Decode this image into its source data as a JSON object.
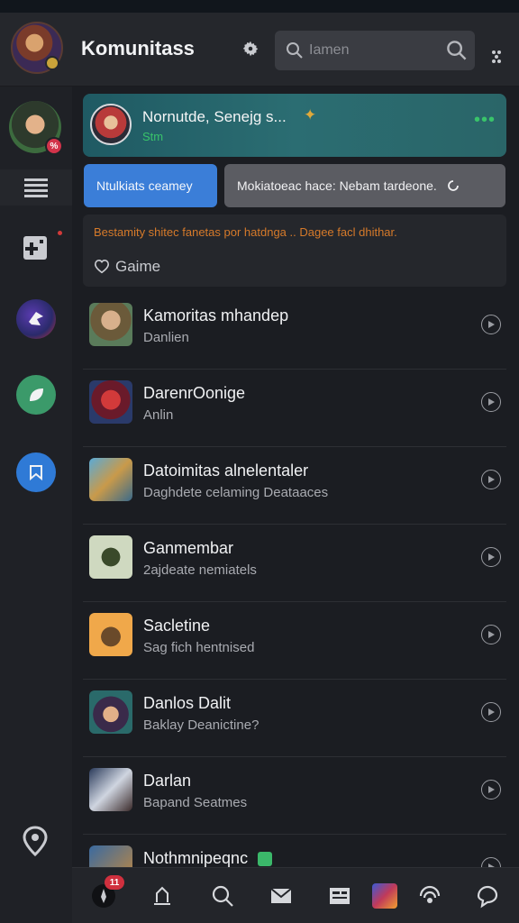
{
  "header": {
    "title": "Komunitass",
    "search_placeholder": "Iamen"
  },
  "sidebar": {
    "avatar_badge": "%"
  },
  "featured": {
    "title": "Nornutde, Senejg s... ",
    "subtitle": "Stm",
    "emoji": "✦"
  },
  "actions": {
    "primary_label": "Ntulkiats ceamey",
    "secondary_label": "Mokiatoeac hace: Nebam tardeone."
  },
  "notice": {
    "text": "Bestamity shitec fanetas por hatdnga .. Dagee facl dhithar.",
    "game_label": "Gaime"
  },
  "list": [
    {
      "title": "Kamoritas mhandep",
      "subtitle": "Danlien",
      "thumb": "avatar-woman"
    },
    {
      "title": "DarenrOonige",
      "subtitle": "Anlin",
      "thumb": "avatar-red-knight"
    },
    {
      "title": "Datoimitas alnelentaler",
      "subtitle": "Daghdete celaming Deataaces",
      "thumb": "crossbow"
    },
    {
      "title": "Ganmembar",
      "subtitle": "2ajdeate nemiatels",
      "thumb": "soldier"
    },
    {
      "title": "Sacletine",
      "subtitle": "Sag fich hentnised",
      "thumb": "wizard"
    },
    {
      "title": "Danlos Dalit",
      "subtitle": "Baklay Deanictine?",
      "thumb": "hat-hero"
    },
    {
      "title": "Darlan",
      "subtitle": "Bapand Seatmes",
      "thumb": "blade"
    },
    {
      "title": "Nothmnipeqnc",
      "subtitle": "",
      "thumb": "gun"
    }
  ],
  "bottom_nav": {
    "notification_count": "11"
  },
  "colors": {
    "accent": "#3b7ed8",
    "teal": "#2b6d72",
    "online": "#39c46a",
    "warning": "#d67a2a",
    "badge": "#d0303e"
  }
}
